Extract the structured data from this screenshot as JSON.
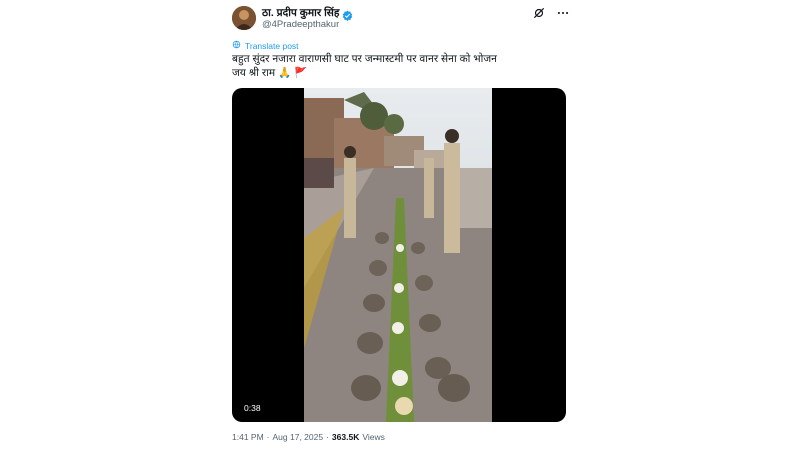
{
  "author": {
    "display_name": "ठा. प्रदीप कुमार सिंह",
    "handle": "@4Pradeepthakur",
    "verified": true
  },
  "icons": [
    "verified-badge-icon",
    "grok-icon",
    "more-options-icon",
    "translate-icon"
  ],
  "translate_label": "Translate post",
  "tweet_text": "बहुत सुंदर नजारा वाराणसी घाट पर जन्मास्टमी पर वानर सेना को भोजन\nजय श्री राम 🙏 🚩",
  "media": {
    "duration": "0:38"
  },
  "meta": {
    "time": "1:41 PM",
    "separator": "·",
    "date": "Aug 17, 2025",
    "views_count": "363.5K",
    "views_label": "Views"
  },
  "colors": {
    "accent": "#1d9bf0",
    "text": "#0f1419",
    "secondary": "#536471"
  }
}
